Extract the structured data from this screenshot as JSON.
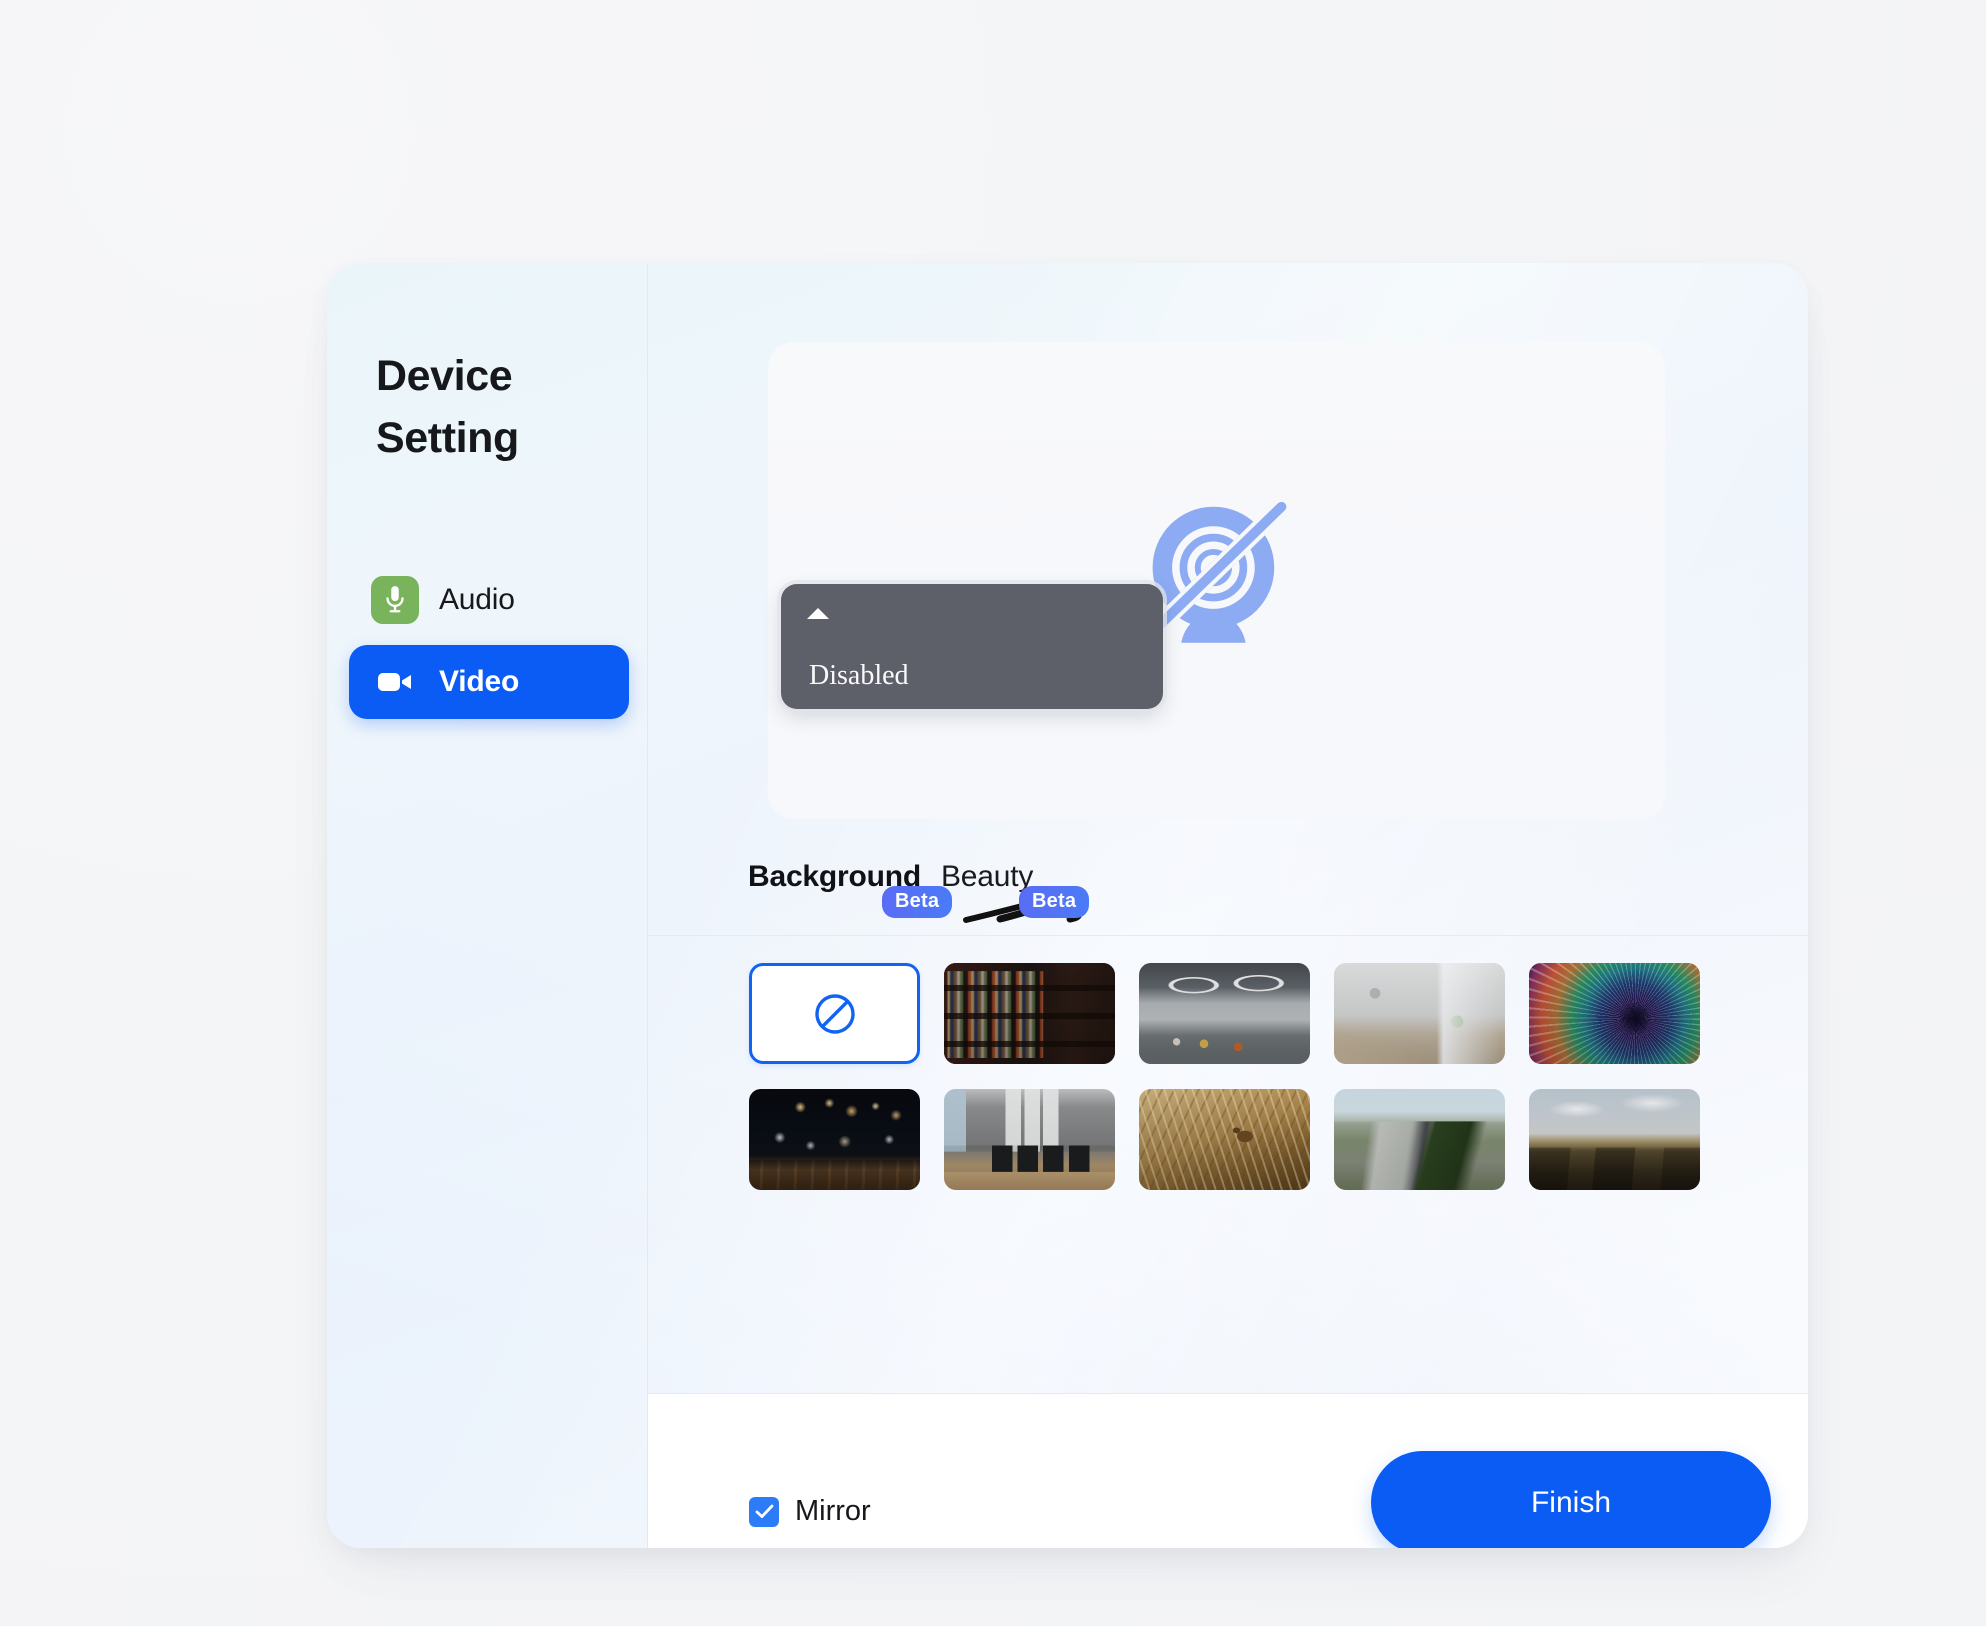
{
  "window": {
    "background_color": "#f4f5f7",
    "card_accent": "#0b5cf5"
  },
  "sidebar": {
    "title": "Device Setting",
    "items": [
      {
        "label": "Audio",
        "icon": "microphone-icon",
        "active": false,
        "icon_color": "#79b35c"
      },
      {
        "label": "Video",
        "icon": "video-camera-icon",
        "active": true,
        "icon_color": "#ffffff"
      }
    ]
  },
  "preview": {
    "icon": "camera-off-icon",
    "icon_color": "#8cabf2",
    "popup": {
      "label": "Disabled",
      "caret": "caret-up-icon",
      "background_color": "#5d6069"
    }
  },
  "tabs": [
    {
      "label": "Background",
      "badge": "Beta",
      "active": true
    },
    {
      "label": "Beauty",
      "badge": "Beta",
      "active": false
    }
  ],
  "annotation": {
    "name": "scribble-underline",
    "color": "#111111"
  },
  "backgrounds": {
    "selected_index": 0,
    "items": [
      {
        "name": "none",
        "label": "None",
        "icon": "no-background-icon",
        "selected": true
      },
      {
        "name": "bookshelf",
        "label": "Bookshelf"
      },
      {
        "name": "modern-office-lounge",
        "label": "Modern office lounge"
      },
      {
        "name": "bright-desk",
        "label": "Bright desk workspace"
      },
      {
        "name": "colorful-vortex",
        "label": "Colorful vortex"
      },
      {
        "name": "bokeh-night-lights",
        "label": "Bokeh night lights"
      },
      {
        "name": "meeting-room",
        "label": "Meeting room"
      },
      {
        "name": "bird-on-reeds",
        "label": "Bird on reeds"
      },
      {
        "name": "river-valley-road",
        "label": "River valley road"
      },
      {
        "name": "cliff-landscape",
        "label": "Cliff landscape"
      }
    ]
  },
  "footer": {
    "mirror_label": "Mirror",
    "mirror_checked": true,
    "finish_label": "Finish"
  }
}
